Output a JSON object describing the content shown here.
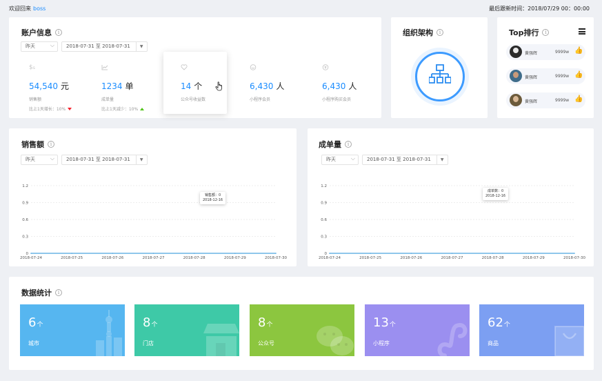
{
  "topbar": {
    "welcome": "欢迎回来",
    "user": "boss",
    "last_login": "最后跟新时间：2018/07/29  00：00:00"
  },
  "account": {
    "title": "账户信息",
    "filter": {
      "period": "昨天",
      "range": "2018-07-31 至 2018-07-31"
    },
    "metrics": [
      {
        "icon": "$",
        "value": "54,540",
        "unit": "元",
        "label": "销售额",
        "trend": "比上1天增长：10%",
        "direction": "down"
      },
      {
        "icon": "chart",
        "value": "1234",
        "unit": "单",
        "label": "成单量",
        "trend": "比上1天减少：10%",
        "direction": "up"
      },
      {
        "icon": "heart",
        "value": "14",
        "unit": "个",
        "label": "公众号收益数"
      },
      {
        "icon": "smile",
        "value": "6,430",
        "unit": "人",
        "label": "小程序会员"
      },
      {
        "icon": "yen",
        "value": "6,430",
        "unit": "人",
        "label": "小程序购买会员"
      }
    ]
  },
  "org": {
    "title": "组织架构"
  },
  "top": {
    "title": "Top排行",
    "items": [
      {
        "name": "黄强辉",
        "amount": "9999w",
        "avatar_color": "#2a2a2a"
      },
      {
        "name": "黄强辉",
        "amount": "9999w",
        "avatar_color": "#3f6c8a"
      },
      {
        "name": "黄强辉",
        "amount": "9999w",
        "avatar_color": "#6b5a3b"
      }
    ]
  },
  "sales": {
    "title": "销售额",
    "filter": {
      "period": "昨天",
      "range": "2018-07-31 至 2018-07-31"
    },
    "tooltip": {
      "line1": "销售额：0",
      "line2": "2018-12-16"
    }
  },
  "orders": {
    "title": "成单量",
    "filter": {
      "period": "昨天",
      "range": "2018-07-31 至 2018-07-31"
    },
    "tooltip": {
      "line1": "成单数：0",
      "line2": "2018-12-16"
    }
  },
  "chart_data": [
    {
      "type": "line",
      "title": "销售额",
      "x": [
        "2018-07-24",
        "2018-07-25",
        "2018-07-26",
        "2018-07-27",
        "2018-07-28",
        "2018-07-29",
        "2018-07-30"
      ],
      "series": [
        {
          "values": [
            0,
            0,
            0,
            0,
            0,
            0,
            0
          ]
        }
      ],
      "yticks": [
        "0",
        "0.3",
        "0.6",
        "0.9",
        "1.2"
      ],
      "ylim": [
        0,
        1.2
      ],
      "grid": true,
      "color": "#4aa3df"
    },
    {
      "type": "line",
      "title": "成单量",
      "x": [
        "2018-07-24",
        "2018-07-25",
        "2018-07-26",
        "2018-07-27",
        "2018-07-28",
        "2018-07-29",
        "2018-07-30"
      ],
      "series": [
        {
          "values": [
            0,
            0,
            0,
            0,
            0,
            0,
            0
          ]
        }
      ],
      "yticks": [
        "0",
        "0.3",
        "0.6",
        "0.9",
        "1.2"
      ],
      "ylim": [
        0,
        1.2
      ],
      "grid": true,
      "color": "#4aa3df"
    }
  ],
  "stats": {
    "title": "数据统计",
    "tiles": [
      {
        "value": "6",
        "unit": "个",
        "label": "城市",
        "color": "#56b6f0",
        "icon": "city-icon"
      },
      {
        "value": "8",
        "unit": "个",
        "label": "门店",
        "color": "#3ec9a7",
        "icon": "store-icon"
      },
      {
        "value": "8",
        "unit": "个",
        "label": "公众号",
        "color": "#8cc63f",
        "icon": "wechat-icon"
      },
      {
        "value": "13",
        "unit": "个",
        "label": "小程序",
        "color": "#9b8ff0",
        "icon": "miniprogram-icon"
      },
      {
        "value": "62",
        "unit": "个",
        "label": "商品",
        "color": "#7c9ff2",
        "icon": "shopping-bag-icon"
      }
    ]
  }
}
